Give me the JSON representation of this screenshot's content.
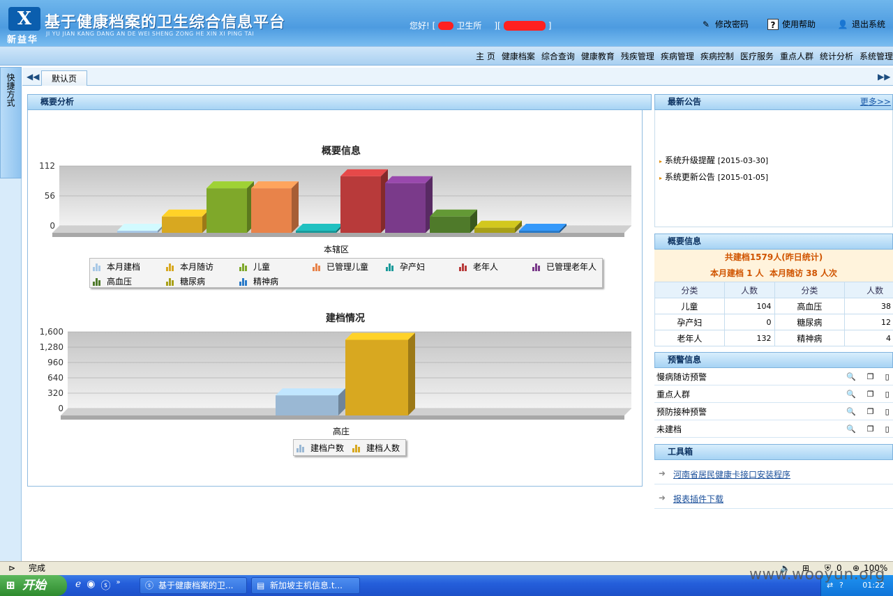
{
  "header": {
    "brand": "新益华",
    "title": "基于健康档案的卫生综合信息平台",
    "pinyin": "JI YU JIAN KANG DANG AN DE WEI SHENG ZONG HE XIN XI PING TAI",
    "greeting_prefix": "您好! [",
    "greeting_org": "卫生所",
    "greeting_mid": "][",
    "greeting_suffix": "]",
    "change_password": "修改密码",
    "help": "使用帮助",
    "logout": "退出系统"
  },
  "nav": [
    "主 页",
    "健康档案",
    "综合查询",
    "健康教育",
    "残疾管理",
    "疾病管理",
    "疾病控制",
    "医疗服务",
    "重点人群",
    "统计分析",
    "系统管理"
  ],
  "sidebar": {
    "shortcut": "快捷方式"
  },
  "tabs": {
    "default": "默认页"
  },
  "overview": {
    "heading": "概要分析"
  },
  "chart_data": [
    {
      "type": "bar",
      "title": "概要信息",
      "categories": [
        "本辖区"
      ],
      "xlabel": "本辖区",
      "yticks": [
        "112",
        "56",
        "0"
      ],
      "ylim": [
        0,
        140
      ],
      "series": [
        {
          "name": "本月建档",
          "values": [
            1
          ],
          "color": "#a8c8e6"
        },
        {
          "name": "本月随访",
          "values": [
            38
          ],
          "color": "#d8a820"
        },
        {
          "name": "儿童",
          "values": [
            104
          ],
          "color": "#7fa82a"
        },
        {
          "name": "已管理儿童",
          "values": [
            104
          ],
          "color": "#e8834a"
        },
        {
          "name": "孕产妇",
          "values": [
            0
          ],
          "color": "#1a9a9a"
        },
        {
          "name": "老年人",
          "values": [
            132
          ],
          "color": "#b83a3a"
        },
        {
          "name": "已管理老年人",
          "values": [
            116
          ],
          "color": "#7a3a8a"
        },
        {
          "name": "高血压",
          "values": [
            38
          ],
          "color": "#4f7a2a"
        },
        {
          "name": "糖尿病",
          "values": [
            12
          ],
          "color": "#a8a018"
        },
        {
          "name": "精神病",
          "values": [
            4
          ],
          "color": "#2a7ac8"
        }
      ]
    },
    {
      "type": "bar",
      "title": "建档情况",
      "categories": [
        "高庄"
      ],
      "xlabel": "高庄",
      "yticks": [
        "1,600",
        "1,280",
        "960",
        "640",
        "320",
        "0"
      ],
      "ylim": [
        0,
        1600
      ],
      "series": [
        {
          "name": "建档户数",
          "values": [
            420
          ],
          "color": "#9ab8d4"
        },
        {
          "name": "建档人数",
          "values": [
            1579
          ],
          "color": "#d8a820"
        }
      ]
    }
  ],
  "announcements": {
    "heading": "最新公告",
    "more": "更多>>",
    "items": [
      {
        "title": "系统升级提醒",
        "date": "[2015-03-30]"
      },
      {
        "title": "系统更新公告",
        "date": "[2015-01-05]"
      }
    ]
  },
  "summary": {
    "heading": "概要信息",
    "total_line": "共建档1579人(昨日统计)",
    "month_line": "本月建档 1 人  本月随访 38 人次",
    "col_category": "分类",
    "col_count": "人数",
    "rows": [
      {
        "c1": "儿童",
        "v1": "104",
        "c2": "高血压",
        "v2": "38"
      },
      {
        "c1": "孕产妇",
        "v1": "0",
        "c2": "糖尿病",
        "v2": "12"
      },
      {
        "c1": "老年人",
        "v1": "132",
        "c2": "精神病",
        "v2": "4"
      }
    ]
  },
  "alerts": {
    "heading": "预警信息",
    "items": [
      "慢病随访预警",
      "重点人群",
      "预防接种预警",
      "未建档"
    ]
  },
  "toolbox": {
    "heading": "工具箱",
    "items": [
      "河南省居民健康卡接口安装程序",
      "报表插件下载"
    ]
  },
  "statusbar": {
    "text": "完成",
    "zoom": "100%",
    "count": "0"
  },
  "taskbar": {
    "start": "开始",
    "tasks": [
      "基于健康档案的卫...",
      "新加坡主机信息.t..."
    ],
    "clock": "01:22"
  },
  "watermark": "www.wooyun.org"
}
